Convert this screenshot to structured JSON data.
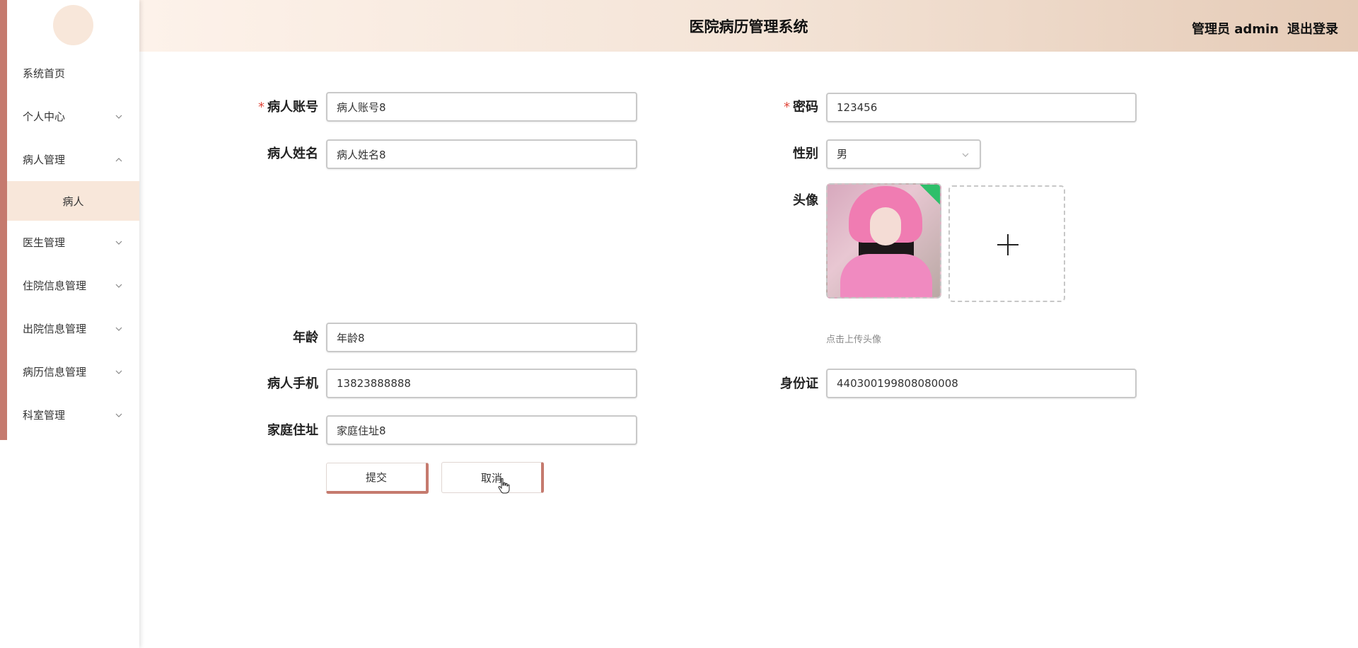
{
  "app": {
    "title": "医院病历管理系统",
    "user_label": "管理员 admin",
    "logout_label": "退出登录"
  },
  "sidebar": {
    "items": [
      {
        "label": "系统首页",
        "has_chevron": false
      },
      {
        "label": "个人中心",
        "has_chevron": true,
        "expanded": false
      },
      {
        "label": "病人管理",
        "has_chevron": true,
        "expanded": true
      },
      {
        "label": "医生管理",
        "has_chevron": true,
        "expanded": false
      },
      {
        "label": "住院信息管理",
        "has_chevron": true,
        "expanded": false
      },
      {
        "label": "出院信息管理",
        "has_chevron": true,
        "expanded": false
      },
      {
        "label": "病历信息管理",
        "has_chevron": true,
        "expanded": false
      },
      {
        "label": "科室管理",
        "has_chevron": true,
        "expanded": false
      }
    ],
    "submenu": {
      "label": "病人"
    }
  },
  "form": {
    "account": {
      "label": "病人账号",
      "value": "病人账号8",
      "required": true
    },
    "password": {
      "label": "密码",
      "value": "123456",
      "required": true
    },
    "name": {
      "label": "病人姓名",
      "value": "病人姓名8"
    },
    "gender": {
      "label": "性别",
      "value": "男"
    },
    "avatar": {
      "label": "头像",
      "hint": "点击上传头像"
    },
    "age": {
      "label": "年龄",
      "value": "年龄8"
    },
    "phone": {
      "label": "病人手机",
      "value": "13823888888"
    },
    "id_card": {
      "label": "身份证",
      "value": "440300199808080008"
    },
    "address": {
      "label": "家庭住址",
      "value": "家庭住址8"
    },
    "required_mark": "*",
    "submit_label": "提交",
    "cancel_label": "取消"
  },
  "colors": {
    "accent": "#c57a6e",
    "submenu_bg": "#f8e7da",
    "required": "#e0463a"
  }
}
